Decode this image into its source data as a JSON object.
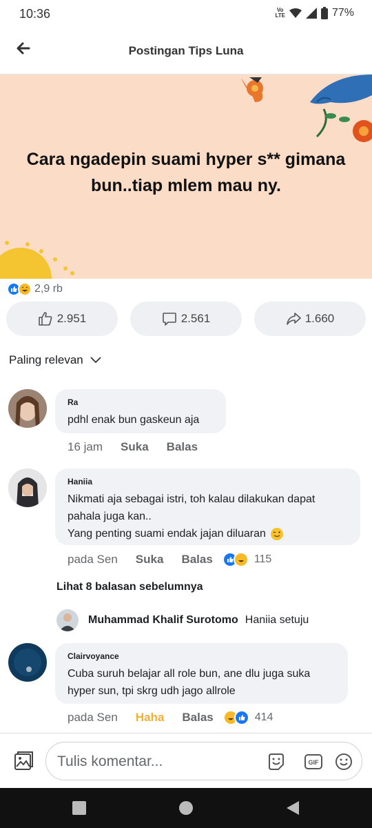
{
  "status_bar": {
    "time": "10:36",
    "network_tag": "Vo\nLTE",
    "battery": "77%"
  },
  "header": {
    "title": "Postingan Tips Luna"
  },
  "post": {
    "text": "Cara ngadepin suami hyper s**  gimana bun..tiap mlem mau ny."
  },
  "reactions": {
    "total": "2,9 rb"
  },
  "actions": {
    "like_count": "2.951",
    "comment_count": "2.561",
    "share_count": "1.660"
  },
  "sort": {
    "label": "Paling relevan"
  },
  "comments": [
    {
      "name": "Ra",
      "text": "pdhl enak bun gaskeun aja",
      "time": "16 jam",
      "like_label": "Suka",
      "reply_label": "Balas"
    },
    {
      "name": "Haniia",
      "text_lines": [
        "Nikmati aja sebagai istri, toh kalau dilakukan dapat",
        "pahala juga kan..",
        "Yang penting suami endak jajan diluaran"
      ],
      "time": "pada Sen",
      "like_label": "Suka",
      "reply_label": "Balas",
      "reaction_count": "115"
    },
    {
      "name": "Clairvoyance",
      "text_lines": [
        "Cuba suruh belajar all role bun, ane dlu juga suka",
        "hyper sun, tpi skrg udh jago allrole"
      ],
      "time": "pada Sen",
      "reacted_label": "Haha",
      "reply_label": "Balas",
      "reaction_count": "414"
    }
  ],
  "replies_link": "Lihat 8 balasan sebelumnya",
  "reply_preview": {
    "name": "Muhammad Khalif Surotomo",
    "text": "Haniia setuju"
  },
  "composer": {
    "placeholder": "Tulis komentar..."
  },
  "colors": {
    "accent": "#1877f2",
    "haha": "#f7b928",
    "bubble": "#f0f2f5",
    "banner": "#fbdcc7"
  },
  "icons": [
    "back-arrow-icon",
    "thumbs-up-icon",
    "comment-icon",
    "share-icon",
    "chevron-down-icon",
    "photo-icon",
    "sticker-icon",
    "gif-icon",
    "emoji-icon"
  ]
}
